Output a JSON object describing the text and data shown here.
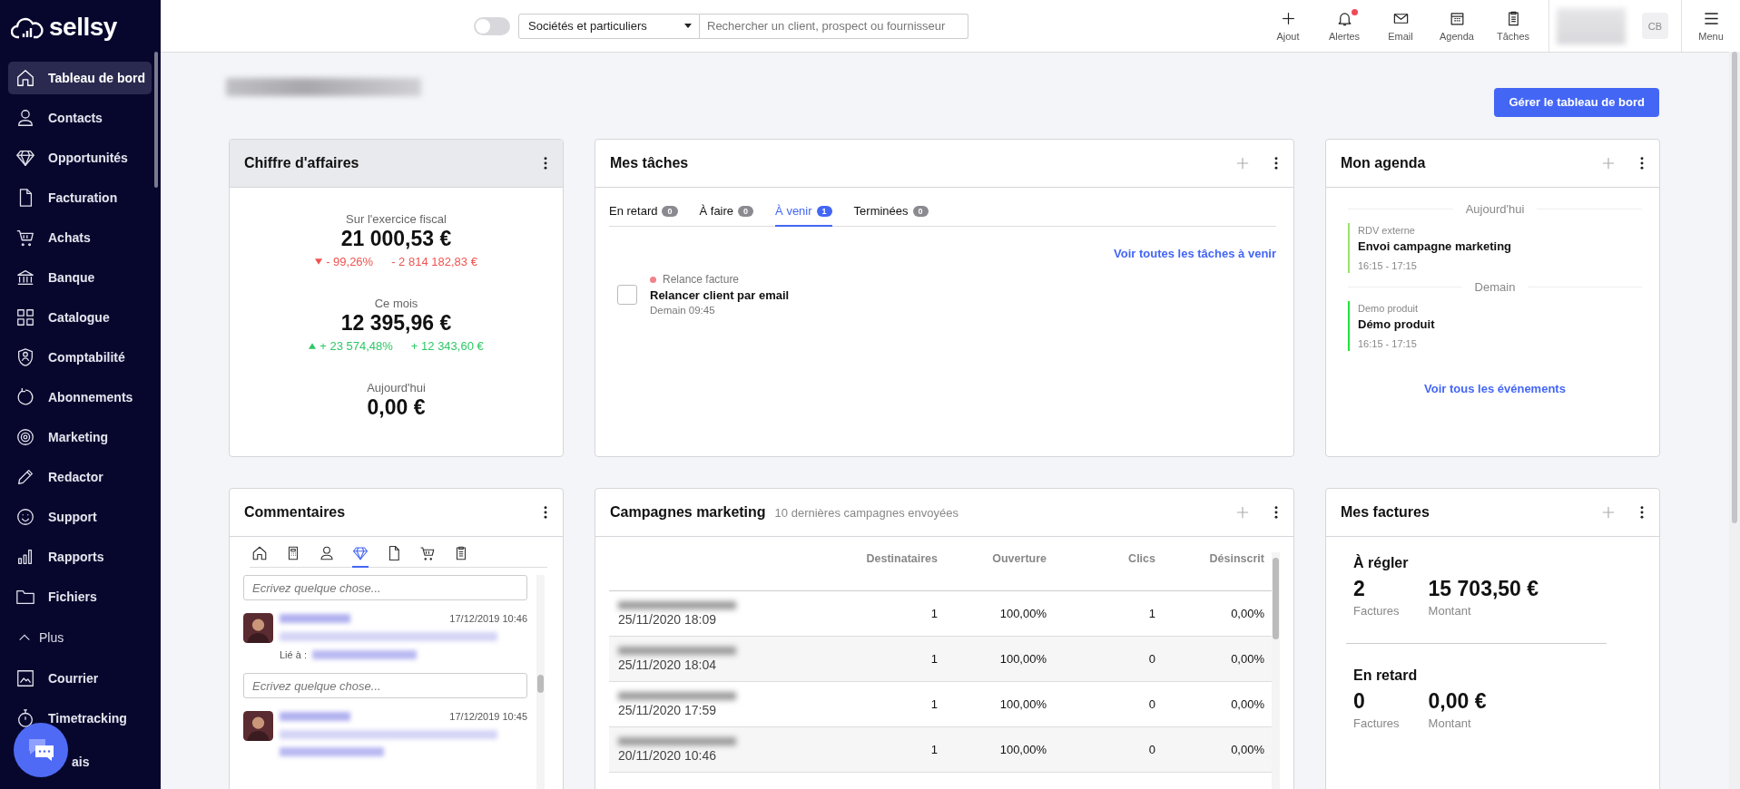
{
  "sidebar": {
    "logo": "sellsy",
    "items": [
      {
        "label": "Tableau de bord",
        "selected": true
      },
      {
        "label": "Contacts",
        "selected": false
      },
      {
        "label": "Opportunités",
        "selected": false
      },
      {
        "label": "Facturation",
        "selected": false
      },
      {
        "label": "Achats",
        "selected": false
      },
      {
        "label": "Banque",
        "selected": false
      },
      {
        "label": "Catalogue",
        "selected": false
      },
      {
        "label": "Comptabilité",
        "selected": false
      },
      {
        "label": "Abonnements",
        "selected": false
      },
      {
        "label": "Marketing",
        "selected": false
      },
      {
        "label": "Redactor",
        "selected": false
      },
      {
        "label": "Support",
        "selected": false
      },
      {
        "label": "Rapports",
        "selected": false
      },
      {
        "label": "Fichiers",
        "selected": false
      }
    ],
    "more": {
      "label": "Plus",
      "expanded": true
    },
    "more_items": [
      {
        "label": "Courrier",
        "selected": false
      },
      {
        "label": "Timetracking",
        "selected": false
      },
      {
        "label": "ais",
        "selected": false
      }
    ]
  },
  "topbar": {
    "toggle": {
      "on": false
    },
    "scope_select": {
      "value": "Sociétés et particuliers"
    },
    "search": {
      "placeholder": "Rechercher un client, prospect ou fournisseur"
    },
    "actions": [
      {
        "label": "Ajout",
        "unread": false
      },
      {
        "label": "Alertes",
        "unread": true
      },
      {
        "label": "Email",
        "unread": false
      },
      {
        "label": "Agenda",
        "unread": false
      },
      {
        "label": "Tâches",
        "unread": false
      }
    ],
    "avatar": {
      "initials": "CB"
    },
    "menu": {
      "label": "Menu"
    }
  },
  "manage_button": "Gérer le tableau de bord",
  "revenue": {
    "title": "Chiffre d'affaires",
    "periods": [
      {
        "label": "Sur l'exercice fiscal",
        "amount": "21 000,53 €",
        "trend": {
          "falling": true,
          "percent": "- 99,26%",
          "amount": "- 2 814 182,83 €"
        }
      },
      {
        "label": "Ce mois",
        "amount": "12 395,96 €",
        "trend": {
          "falling": false,
          "percent": "+ 23 574,48%",
          "amount": "+ 12 343,60 €"
        }
      },
      {
        "label": "Aujourd'hui",
        "amount": "0,00 €"
      }
    ]
  },
  "tasks": {
    "title": "Mes tâches",
    "tabs": [
      {
        "label": "En retard",
        "count": "0",
        "selected": false
      },
      {
        "label": "À faire",
        "count": "0",
        "selected": false
      },
      {
        "label": "À venir",
        "count": "1",
        "selected": true
      },
      {
        "label": "Terminées",
        "count": "0",
        "selected": false
      }
    ],
    "link": "Voir toutes les tâches à venir",
    "items": [
      {
        "category": "Relance facture",
        "color": "#f0838a",
        "title": "Relancer client par email",
        "due": "Demain 09:45",
        "checked": false
      }
    ]
  },
  "agenda": {
    "title": "Mon agenda",
    "days": [
      {
        "label": "Aujourd'hui",
        "events": [
          {
            "type": "RDV externe",
            "title": "Envoi campagne marketing",
            "time": "16:15 - 17:15",
            "color": "#9be36b"
          }
        ]
      },
      {
        "label": "Demain",
        "events": [
          {
            "type": "Demo produit",
            "title": "Démo produit",
            "time": "16:15 - 17:15",
            "color": "#22e33a"
          }
        ]
      }
    ],
    "link": "Voir tous les événements"
  },
  "comments": {
    "title": "Commentaires",
    "tabs": [
      {
        "selected": false
      },
      {
        "selected": false
      },
      {
        "selected": false
      },
      {
        "selected": true
      },
      {
        "selected": false
      },
      {
        "selected": false
      },
      {
        "selected": false
      }
    ],
    "thread": [
      {
        "kind": "field",
        "placeholder": "Ecrivez quelque chose..."
      },
      {
        "kind": "comment",
        "date": "17/12/2019 10:46",
        "linked_label": "Lié à :"
      },
      {
        "kind": "field",
        "placeholder": "Ecrivez quelque chose..."
      },
      {
        "kind": "comment",
        "date": "17/12/2019 10:45"
      }
    ]
  },
  "campaigns": {
    "title": "Campagnes marketing",
    "subtitle": "10 dernières campagnes envoyées",
    "columns": [
      "Destinataires",
      "Ouverture",
      "Clics",
      "Désinscrit"
    ],
    "rows": [
      {
        "date": "25/11/2020 18:09",
        "recipients": "1",
        "open_rate": "100,00%",
        "clicks": "1",
        "unsubscribed": "0,00%"
      },
      {
        "date": "25/11/2020 18:04",
        "recipients": "1",
        "open_rate": "100,00%",
        "clicks": "0",
        "unsubscribed": "0,00%"
      },
      {
        "date": "25/11/2020 17:59",
        "recipients": "1",
        "open_rate": "100,00%",
        "clicks": "0",
        "unsubscribed": "0,00%"
      },
      {
        "date": "20/11/2020 10:46",
        "recipients": "1",
        "open_rate": "100,00%",
        "clicks": "0",
        "unsubscribed": "0,00%"
      }
    ]
  },
  "invoices": {
    "title": "Mes factures",
    "sections": [
      {
        "title": "À régler",
        "count": "2",
        "count_label": "Factures",
        "amount": "15 703,50 €",
        "amount_label": "Montant"
      },
      {
        "title": "En retard",
        "count": "0",
        "count_label": "Factures",
        "amount": "0,00 €",
        "amount_label": "Montant"
      }
    ]
  }
}
